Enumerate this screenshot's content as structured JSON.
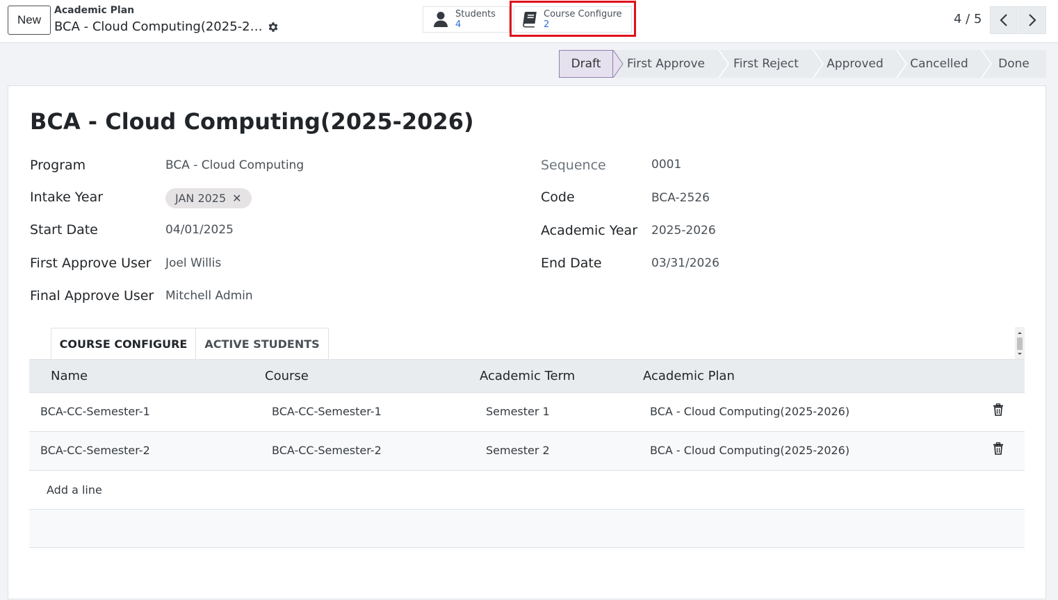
{
  "header": {
    "new_label": "New",
    "breadcrumb_parent": "Academic Plan",
    "breadcrumb_current": "BCA - Cloud Computing(2025-2…",
    "gear_icon": "gear-icon"
  },
  "smart_buttons": [
    {
      "label": "Students",
      "value": "4",
      "icon": "user-icon"
    },
    {
      "label": "Course Configure",
      "value": "2",
      "icon": "book-icon"
    }
  ],
  "pager": {
    "value": "4 / 5",
    "prev_icon": "chevron-left-icon",
    "next_icon": "chevron-right-icon"
  },
  "statusbar": {
    "stages": [
      "Draft",
      "First Approve",
      "First Reject",
      "Approved",
      "Cancelled",
      "Done"
    ],
    "active": "Draft"
  },
  "form": {
    "title": "BCA - Cloud Computing(2025-2026)",
    "left": {
      "program_label": "Program",
      "program_value": "BCA - Cloud Computing",
      "intake_label": "Intake Year",
      "intake_tag": "JAN 2025",
      "start_label": "Start Date",
      "start_value": "04/01/2025",
      "first_user_label": "First Approve User",
      "first_user_value": "Joel Willis",
      "final_user_label": "Final Approve User",
      "final_user_value": "Mitchell Admin"
    },
    "right": {
      "sequence_label": "Sequence",
      "sequence_value": "0001",
      "code_label": "Code",
      "code_value": "BCA-2526",
      "year_label": "Academic Year",
      "year_value": "2025-2026",
      "end_label": "End Date",
      "end_value": "03/31/2026"
    }
  },
  "tabs": [
    "COURSE CONFIGURE",
    "ACTIVE STUDENTS"
  ],
  "table": {
    "columns": [
      "Name",
      "Course",
      "Academic Term",
      "Academic Plan"
    ],
    "rows": [
      [
        "BCA-CC-Semester-1",
        "BCA-CC-Semester-1",
        "Semester 1",
        "BCA - Cloud Computing(2025-2026)"
      ],
      [
        "BCA-CC-Semester-2",
        "BCA-CC-Semester-2",
        "Semester 2",
        "BCA - Cloud Computing(2025-2026)"
      ]
    ],
    "add_line": "Add a line"
  },
  "colors": {
    "highlight": "#e0101a",
    "link": "#2f6fd0",
    "active_stage_border": "#8f7fa9"
  }
}
